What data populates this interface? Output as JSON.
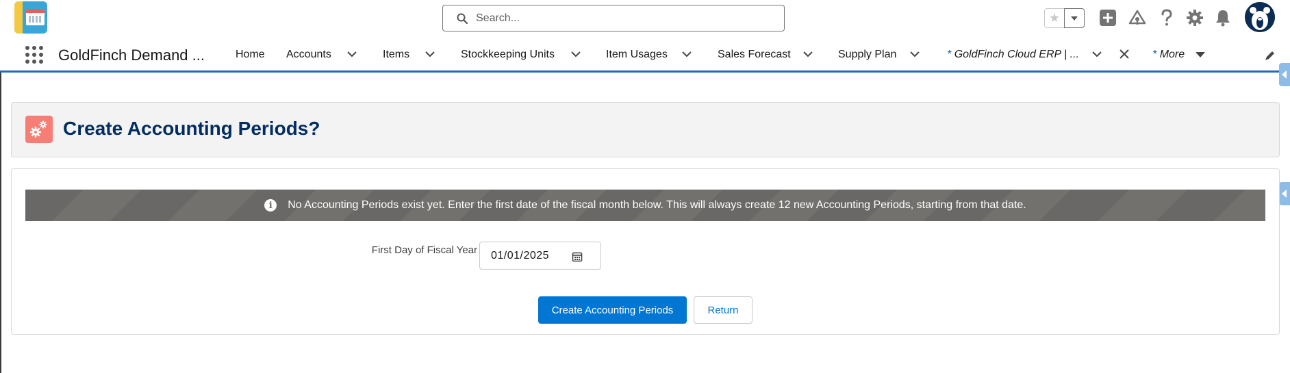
{
  "header": {
    "search_placeholder": "Search...",
    "icons": [
      "favorite-star-icon",
      "favorites-dropdown-icon",
      "global-actions-add-icon",
      "trailhead-icon",
      "help-icon",
      "setup-gear-icon",
      "notifications-bell-icon",
      "user-avatar"
    ]
  },
  "nav": {
    "app_name": "GoldFinch Demand ...",
    "items": [
      {
        "label": "Home"
      },
      {
        "label": "Accounts"
      },
      {
        "label": "Items"
      },
      {
        "label": "Stockkeeping Units"
      },
      {
        "label": "Item Usages"
      },
      {
        "label": "Sales Forecast"
      },
      {
        "label": "Supply Plan"
      }
    ],
    "active_tab": {
      "prefix": "*",
      "label": "GoldFinch Cloud ERP | ..."
    },
    "more": {
      "prefix": "*",
      "label": "More"
    }
  },
  "page": {
    "title": "Create Accounting Periods?",
    "icon": "gears-icon"
  },
  "form": {
    "info_message": "No Accounting Periods exist yet. Enter the first date of the fiscal month below. This will always create 12 new Accounting Periods, starting from that date.",
    "field_label": "First Day of Fiscal Year",
    "date_value": "01/01/2025",
    "primary_button": "Create Accounting Periods",
    "secondary_button": "Return"
  },
  "colors": {
    "brand_blue": "#0176d3",
    "title_navy": "#032d60",
    "banner_gray": "#706e6b",
    "page_icon_coral": "#f77e75",
    "nav_underline": "#1b6ac9"
  }
}
